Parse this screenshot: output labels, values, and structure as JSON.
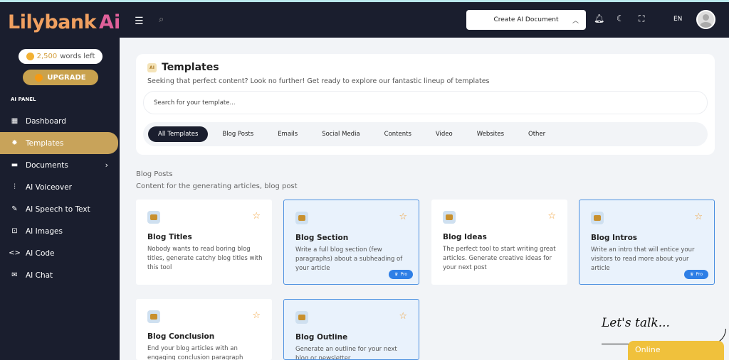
{
  "app": {
    "logo_text": "Lilybank",
    "logo_ai": "Ai",
    "words_count": "2,500",
    "words_suffix": "words left",
    "upgrade_label": "UPGRADE",
    "panel_label": "AI PANEL",
    "accent": "#c8a35a"
  },
  "sidebar": {
    "items": [
      {
        "label": "Dashboard",
        "icon": "dashboard-icon",
        "glyph": "▦",
        "active": false
      },
      {
        "label": "Templates",
        "icon": "templates-icon",
        "glyph": "✹",
        "active": true
      },
      {
        "label": "Documents",
        "icon": "folder-icon",
        "glyph": "▬",
        "active": false,
        "chevron": true
      },
      {
        "label": "AI Voiceover",
        "icon": "waveform-icon",
        "glyph": "⫶",
        "active": false
      },
      {
        "label": "AI Speech to Text",
        "icon": "speech-icon",
        "glyph": "✎",
        "active": false
      },
      {
        "label": "AI Images",
        "icon": "image-icon",
        "glyph": "⊡",
        "active": false
      },
      {
        "label": "AI Code",
        "icon": "code-icon",
        "glyph": "<>",
        "active": false
      },
      {
        "label": "AI Chat",
        "icon": "chat-icon",
        "glyph": "✉",
        "active": false
      }
    ]
  },
  "topbar": {
    "create_label": "Create AI Document",
    "lang": "EN"
  },
  "templates": {
    "title": "Templates",
    "ai_badge": "AI",
    "subtitle": "Seeking that perfect content? Look no further! Get ready to explore our fantastic lineup of templates",
    "search_placeholder": "Search for your template...",
    "tabs": [
      "All Templates",
      "Blog Posts",
      "Emails",
      "Social Media",
      "Contents",
      "Video",
      "Websites",
      "Other"
    ]
  },
  "section": {
    "title": "Blog Posts",
    "subtitle": "Content for the generating articles, blog post"
  },
  "cards": [
    {
      "title": "Blog Titles",
      "desc": "Nobody wants to read boring blog titles, generate catchy blog titles with this tool",
      "pro": false
    },
    {
      "title": "Blog Section",
      "desc": "Write a full blog section (few paragraphs) about a subheading of your article",
      "pro": true
    },
    {
      "title": "Blog Ideas",
      "desc": "The perfect tool to start writing great articles. Generate creative ideas for your next post",
      "pro": false
    },
    {
      "title": "Blog Intros",
      "desc": "Write an intro that will entice your visitors to read more about your article",
      "pro": true
    },
    {
      "title": "Blog Conclusion",
      "desc": "End your blog articles with an engaging conclusion paragraph",
      "pro": false
    },
    {
      "title": "Blog Outline",
      "desc": "Generate an outline for your next blog or newsletter",
      "pro": false
    }
  ],
  "pro_label": "Pro",
  "chat": {
    "lets_talk": "Let's talk...",
    "online": "Online"
  }
}
